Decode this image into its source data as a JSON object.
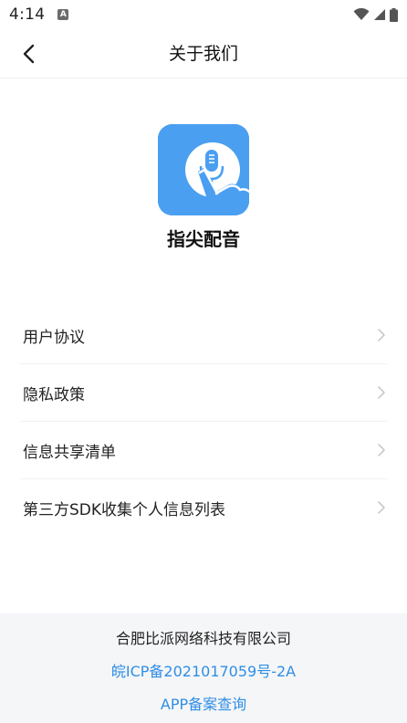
{
  "status_bar": {
    "time": "4:14",
    "icons": [
      "a-notification-icon",
      "wifi-icon",
      "signal-icon",
      "battery-icon"
    ]
  },
  "header": {
    "title": "关于我们",
    "back_icon": "back-arrow-icon"
  },
  "app": {
    "name": "指尖配音",
    "logo_icon": "microphone-hand-icon",
    "logo_color": "#4a9ff1"
  },
  "menu": {
    "items": [
      {
        "label": "用户协议"
      },
      {
        "label": "隐私政策"
      },
      {
        "label": "信息共享清单"
      },
      {
        "label": "第三方SDK收集个人信息列表"
      }
    ],
    "chevron_icon": "chevron-right-icon"
  },
  "footer": {
    "company": "合肥比派网络科技有限公司",
    "icp": "皖ICP备2021017059号-2A",
    "app_record": "APP备案查询",
    "link_color": "#2f8ee5"
  }
}
